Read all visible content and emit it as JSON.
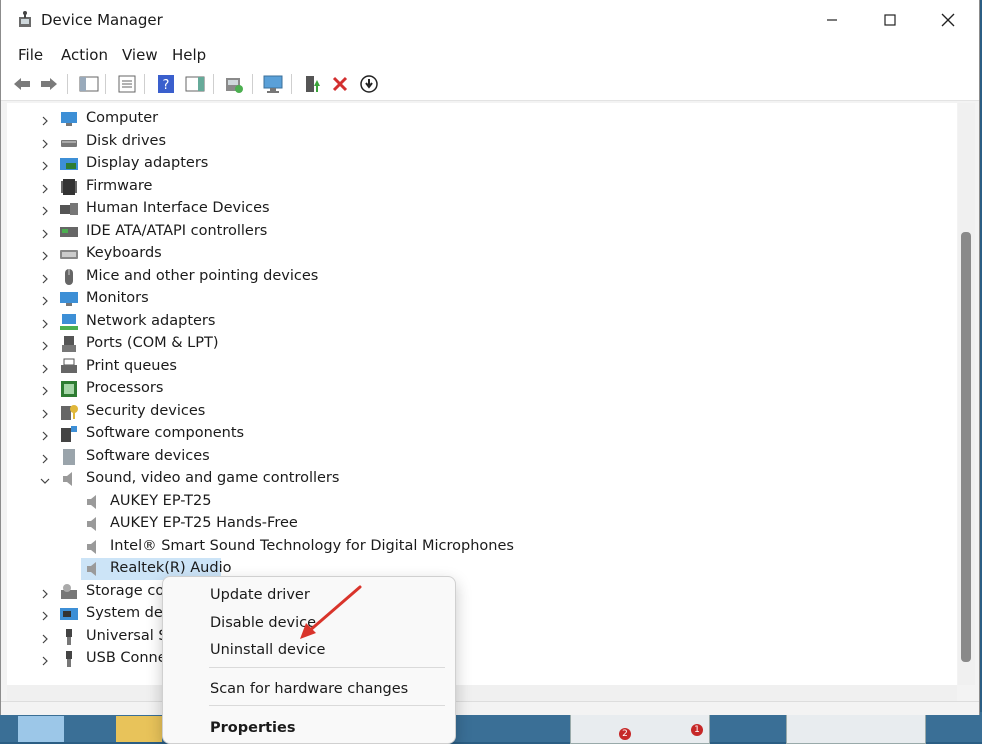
{
  "window": {
    "title": "Device Manager",
    "controls": [
      "minimize",
      "maximize",
      "close"
    ]
  },
  "menubar": [
    "File",
    "Action",
    "View",
    "Help"
  ],
  "toolbar": {
    "icons": [
      "back-arrow-icon",
      "forward-arrow-icon",
      "show-hide-console-tree-icon",
      "properties-icon",
      "help-icon",
      "show-action-pane-icon",
      "update-driver-icon",
      "scan-hardware-icon",
      "enable-device-icon",
      "uninstall-device-icon",
      "disable-device-icon"
    ]
  },
  "tree": {
    "categories": [
      {
        "label": "Computer",
        "icon": "computer-icon",
        "expanded": false
      },
      {
        "label": "Disk drives",
        "icon": "disk-drive-icon",
        "expanded": false
      },
      {
        "label": "Display adapters",
        "icon": "display-adapter-icon",
        "expanded": false
      },
      {
        "label": "Firmware",
        "icon": "firmware-icon",
        "expanded": false
      },
      {
        "label": "Human Interface Devices",
        "icon": "hid-icon",
        "expanded": false
      },
      {
        "label": "IDE ATA/ATAPI controllers",
        "icon": "ide-controller-icon",
        "expanded": false
      },
      {
        "label": "Keyboards",
        "icon": "keyboard-icon",
        "expanded": false
      },
      {
        "label": "Mice and other pointing devices",
        "icon": "mouse-icon",
        "expanded": false
      },
      {
        "label": "Monitors",
        "icon": "monitor-icon",
        "expanded": false
      },
      {
        "label": "Network adapters",
        "icon": "network-adapter-icon",
        "expanded": false
      },
      {
        "label": "Ports (COM & LPT)",
        "icon": "port-icon",
        "expanded": false
      },
      {
        "label": "Print queues",
        "icon": "printer-icon",
        "expanded": false
      },
      {
        "label": "Processors",
        "icon": "processor-icon",
        "expanded": false
      },
      {
        "label": "Security devices",
        "icon": "security-device-icon",
        "expanded": false
      },
      {
        "label": "Software components",
        "icon": "software-component-icon",
        "expanded": false
      },
      {
        "label": "Software devices",
        "icon": "software-device-icon",
        "expanded": false
      },
      {
        "label": "Sound, video and game controllers",
        "icon": "speaker-icon",
        "expanded": true
      }
    ],
    "sound_children": [
      {
        "label": "AUKEY EP-T25",
        "icon": "speaker-icon"
      },
      {
        "label": "AUKEY EP-T25 Hands-Free",
        "icon": "speaker-icon"
      },
      {
        "label": "Intel® Smart Sound Technology for Digital Microphones",
        "icon": "speaker-icon"
      },
      {
        "label": "Realtek(R) Audio",
        "icon": "speaker-icon",
        "selected": true
      }
    ],
    "after": [
      {
        "label": "Storage con",
        "icon": "storage-controller-icon",
        "expanded": false
      },
      {
        "label": "System devi",
        "icon": "system-device-icon",
        "expanded": false
      },
      {
        "label": "Universal Se",
        "icon": "usb-icon",
        "expanded": false
      },
      {
        "label": "USB Connec",
        "icon": "usb-connector-icon",
        "expanded": false
      }
    ]
  },
  "context_menu": {
    "items": [
      "Update driver",
      "Disable device",
      "Uninstall device",
      "Scan for hardware changes",
      "Properties"
    ]
  },
  "desktop": {
    "badges": [
      "2",
      "1"
    ]
  }
}
